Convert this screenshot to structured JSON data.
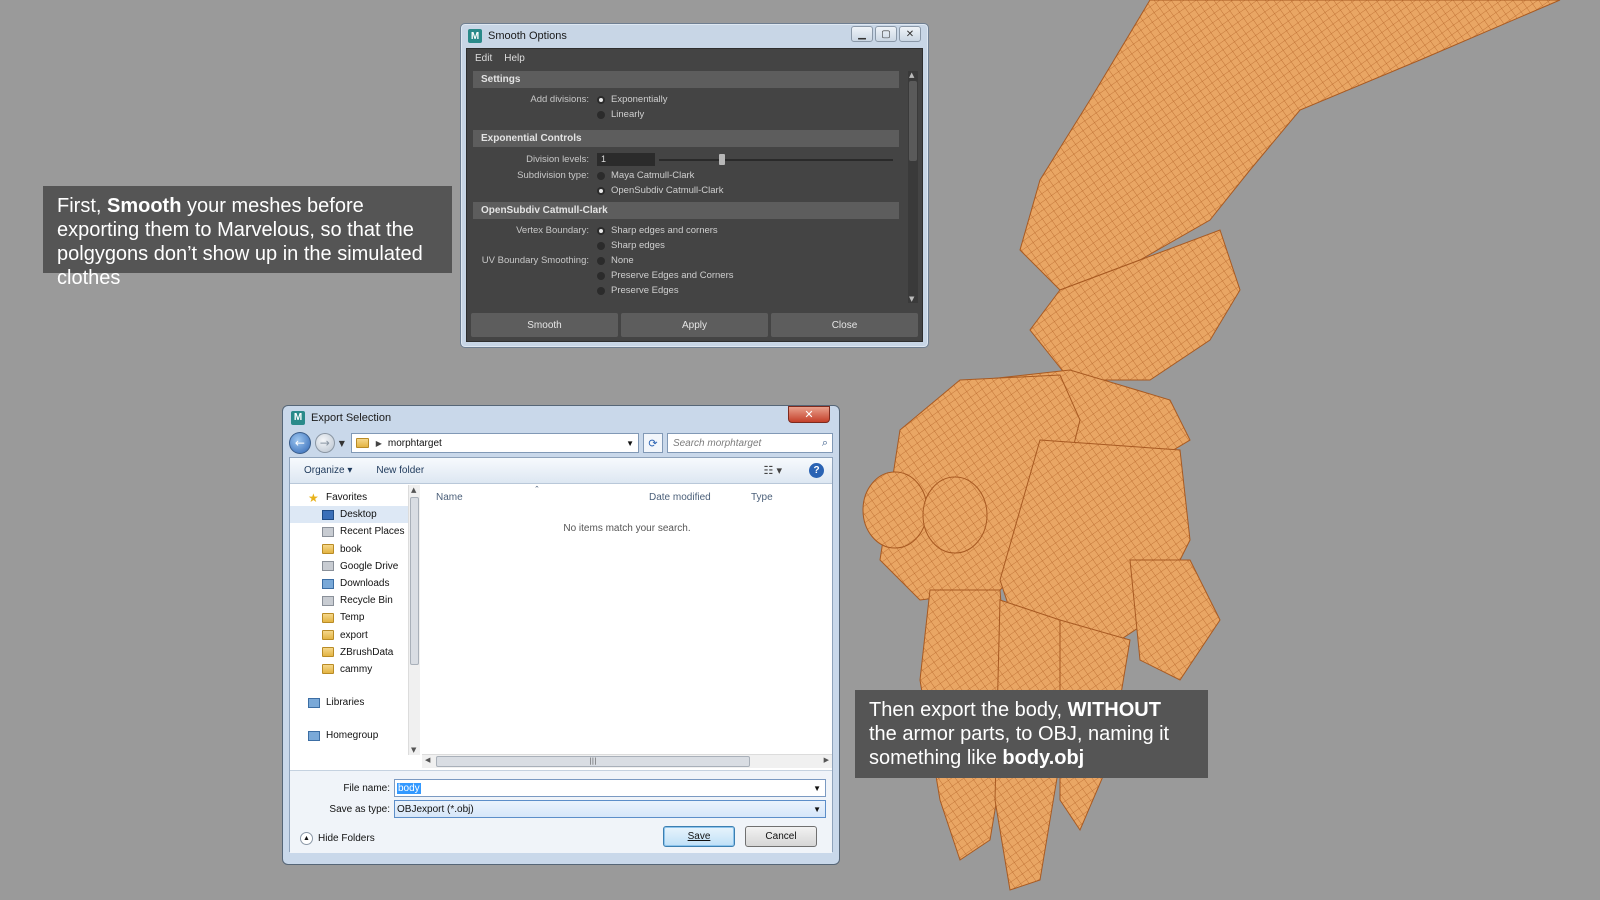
{
  "captions": {
    "first": {
      "pre": "First, ",
      "bold": "Smooth",
      "post": " your meshes before exporting them to Marvelous, so that the polgygons don’t show up in the simulated clothes"
    },
    "second": {
      "pre": "Then export the body, ",
      "bold": "WITHOUT",
      "mid": " the armor parts, to OBJ, naming it something like ",
      "bold2": "body.obj"
    }
  },
  "smooth_window": {
    "title": "Smooth Options",
    "logo": "M",
    "menu": [
      "Edit",
      "Help"
    ],
    "sections": {
      "settings": "Settings",
      "exponential": "Exponential Controls",
      "opensubdiv": "OpenSubdiv Catmull-Clark"
    },
    "add_divisions": {
      "label": "Add divisions:",
      "options": [
        "Exponentially",
        "Linearly"
      ],
      "selected": 0
    },
    "division_levels": {
      "label": "Division levels:",
      "value": "1",
      "slider_fraction": 0.27
    },
    "subdivision_type": {
      "label": "Subdivision type:",
      "options": [
        "Maya Catmull-Clark",
        "OpenSubdiv Catmull-Clark"
      ],
      "selected": 1
    },
    "vertex_boundary": {
      "label": "Vertex Boundary:",
      "options": [
        "Sharp edges and corners",
        "Sharp edges"
      ],
      "selected": 0
    },
    "uv_boundary": {
      "label": "UV Boundary Smoothing:",
      "options": [
        "None",
        "Preserve Edges and Corners",
        "Preserve Edges"
      ],
      "selected": -1
    },
    "buttons": [
      "Smooth",
      "Apply",
      "Close"
    ]
  },
  "export_window": {
    "title": "Export Selection",
    "logo": "M",
    "address": "morphtarget",
    "search_placeholder": "Search morphtarget",
    "organize": "Organize ▾",
    "new_folder": "New folder",
    "nav": {
      "favorites": "Favorites",
      "items": [
        "Desktop",
        "Recent Places",
        "book",
        "Google Drive",
        "Downloads",
        "Recycle Bin",
        "Temp",
        "export",
        "ZBrushData",
        "cammy"
      ],
      "libraries": "Libraries",
      "homegroup": "Homegroup"
    },
    "columns": [
      "Name",
      "Date modified",
      "Type"
    ],
    "empty_message": "No items match your search.",
    "file_name": {
      "label": "File name:",
      "value": "body"
    },
    "save_as_type": {
      "label": "Save as type:",
      "value": "OBJexport (*.obj)"
    },
    "hide_folders": "Hide Folders",
    "save": "Save",
    "cancel": "Cancel"
  },
  "colors": {
    "mesh": "#e8a05c",
    "mesh_line": "#c8763a",
    "background": "#9a9a9a"
  }
}
